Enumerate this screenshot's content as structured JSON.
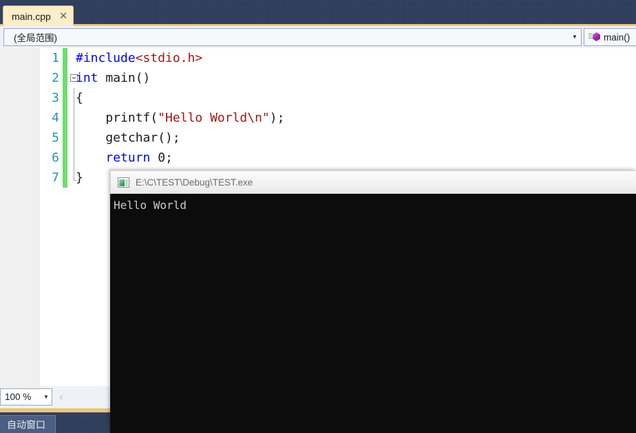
{
  "tab_strip": {
    "tabs": [
      {
        "label": "main.cpp",
        "close_glyph": "✕"
      }
    ]
  },
  "nav_bar": {
    "scope_combo": {
      "value": "(全局范围)",
      "arrow_glyph": "▼"
    },
    "member_combo": {
      "value": "main()",
      "icon": "method-cube-icon"
    }
  },
  "editor": {
    "lines": [
      {
        "number": "1",
        "fold": "none",
        "tokens": [
          {
            "text": "#include",
            "cls": "t-pre"
          },
          {
            "text": "<stdio.h>",
            "cls": "t-str"
          }
        ]
      },
      {
        "number": "2",
        "fold": "collapse",
        "tokens": [
          {
            "text": "int",
            "cls": "t-kw"
          },
          {
            "text": " main()",
            "cls": "t-plain"
          }
        ]
      },
      {
        "number": "3",
        "fold": "line",
        "tokens": [
          {
            "text": "{",
            "cls": "t-plain"
          }
        ]
      },
      {
        "number": "4",
        "fold": "line",
        "tokens": [
          {
            "text": "    printf(",
            "cls": "t-plain"
          },
          {
            "text": "\"Hello World\\n\"",
            "cls": "t-str"
          },
          {
            "text": ");",
            "cls": "t-plain"
          }
        ]
      },
      {
        "number": "5",
        "fold": "line",
        "tokens": [
          {
            "text": "    getchar();",
            "cls": "t-plain"
          }
        ]
      },
      {
        "number": "6",
        "fold": "line",
        "tokens": [
          {
            "text": "    ",
            "cls": "t-plain"
          },
          {
            "text": "return",
            "cls": "t-kw"
          },
          {
            "text": " 0;",
            "cls": "t-num"
          }
        ]
      },
      {
        "number": "7",
        "fold": "end",
        "tokens": [
          {
            "text": "}",
            "cls": "t-plain"
          }
        ]
      }
    ]
  },
  "zoom_strip": {
    "zoom_value": "100 %",
    "zoom_arrow_glyph": "▼",
    "nav_back_glyph": "‹"
  },
  "bottom_dock": {
    "tabs": [
      {
        "label": "自动窗口"
      }
    ]
  },
  "console_window": {
    "title": "E:\\C\\TEST\\Debug\\TEST.exe",
    "output_lines": [
      "Hello World"
    ]
  },
  "colors": {
    "chrome_dark": "#2d3c5b",
    "accent_yellow": "#e8c97a",
    "tab_cream": "#fbeec8",
    "linenum_blue": "#2b91af",
    "keyword_blue": "#0000ff",
    "string_maroon": "#a31515",
    "changebar_green": "#6fdd6f",
    "console_black": "#0c0c0c",
    "console_text": "#cccccc"
  }
}
